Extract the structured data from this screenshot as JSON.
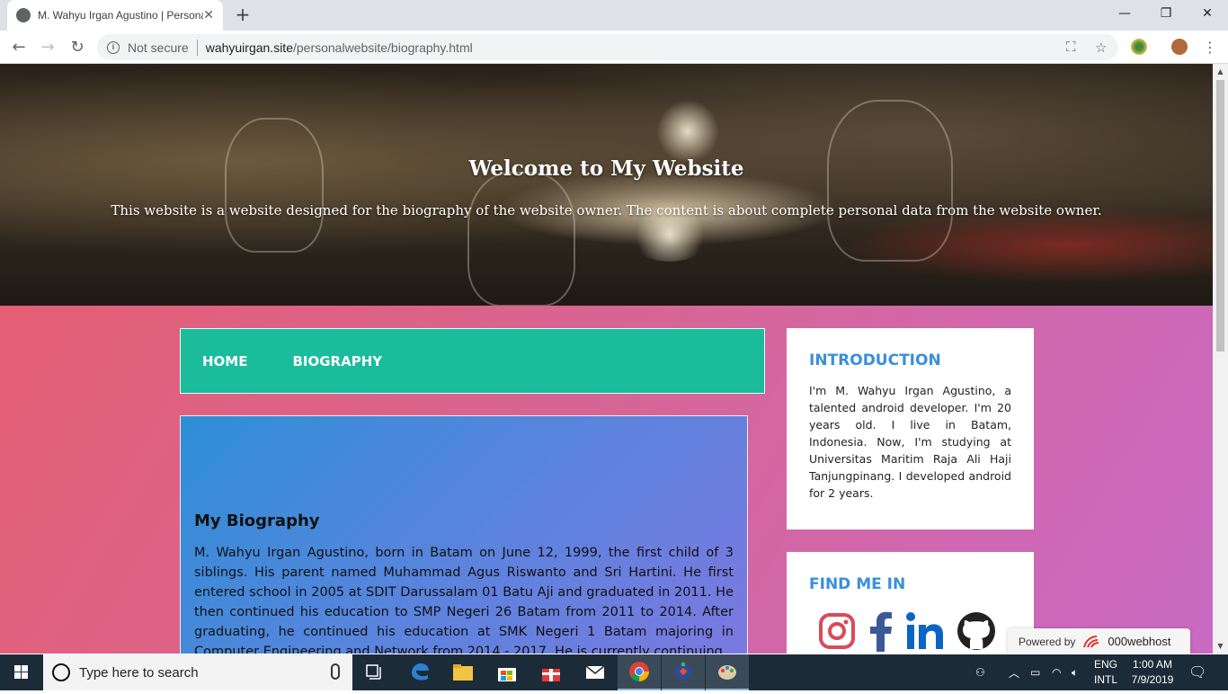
{
  "browser": {
    "tab_title": "M. Wahyu Irgan Agustino | Personal Website",
    "new_tab": "+",
    "url_secure_label": "Not secure",
    "url_host": "wahyuirgan.site",
    "url_path": "/personalwebsite/biography.html"
  },
  "hero": {
    "title": "Welcome to My Website",
    "subtitle": "This website is a website designed for the biography of the website owner. The content is about complete personal data from the website owner."
  },
  "nav": {
    "items": [
      {
        "label": "HOME"
      },
      {
        "label": "BIOGRAPHY"
      }
    ]
  },
  "bio": {
    "heading": "My Biography",
    "text": "M. Wahyu Irgan Agustino, born in Batam on June 12, 1999, the first child of 3 siblings. His parent named Muhammad Agus Riswanto and Sri Hartini. He first entered school in 2005 at SDIT Darussalam 01 Batu Aji and graduated in 2011. He then continued his education to SMP Negeri 26 Batam from 2011 to 2014. After graduating, he continued his education at SMK Negeri 1 Batam majoring in Computer Engineering and Network from 2014 - 2017. He is currently continuing"
  },
  "intro": {
    "heading": "INTRODUCTION",
    "text": "I'm M. Wahyu Irgan Agustino, a talented android developer. I'm 20 years old. I live in Batam, Indonesia. Now, I'm studying at Universitas Maritim Raja Ali Haji Tanjungpinang. I developed android for 2 years."
  },
  "find": {
    "heading": "FIND ME IN",
    "icons": [
      "instagram-icon",
      "facebook-icon",
      "linkedin-icon",
      "github-icon"
    ]
  },
  "powered": {
    "label": "Powered by",
    "brand": "000webhost"
  },
  "taskbar": {
    "search_placeholder": "Type here to search",
    "lang_line1": "ENG",
    "lang_line2": "INTL",
    "time": "1:00 AM",
    "date": "7/9/2019"
  },
  "colors": {
    "nav_bg": "#1abc9c",
    "card_heading": "#3a8fdc",
    "instagram": "#e1306c",
    "facebook": "#3b5998",
    "linkedin": "#0077b5",
    "github": "#222222"
  }
}
